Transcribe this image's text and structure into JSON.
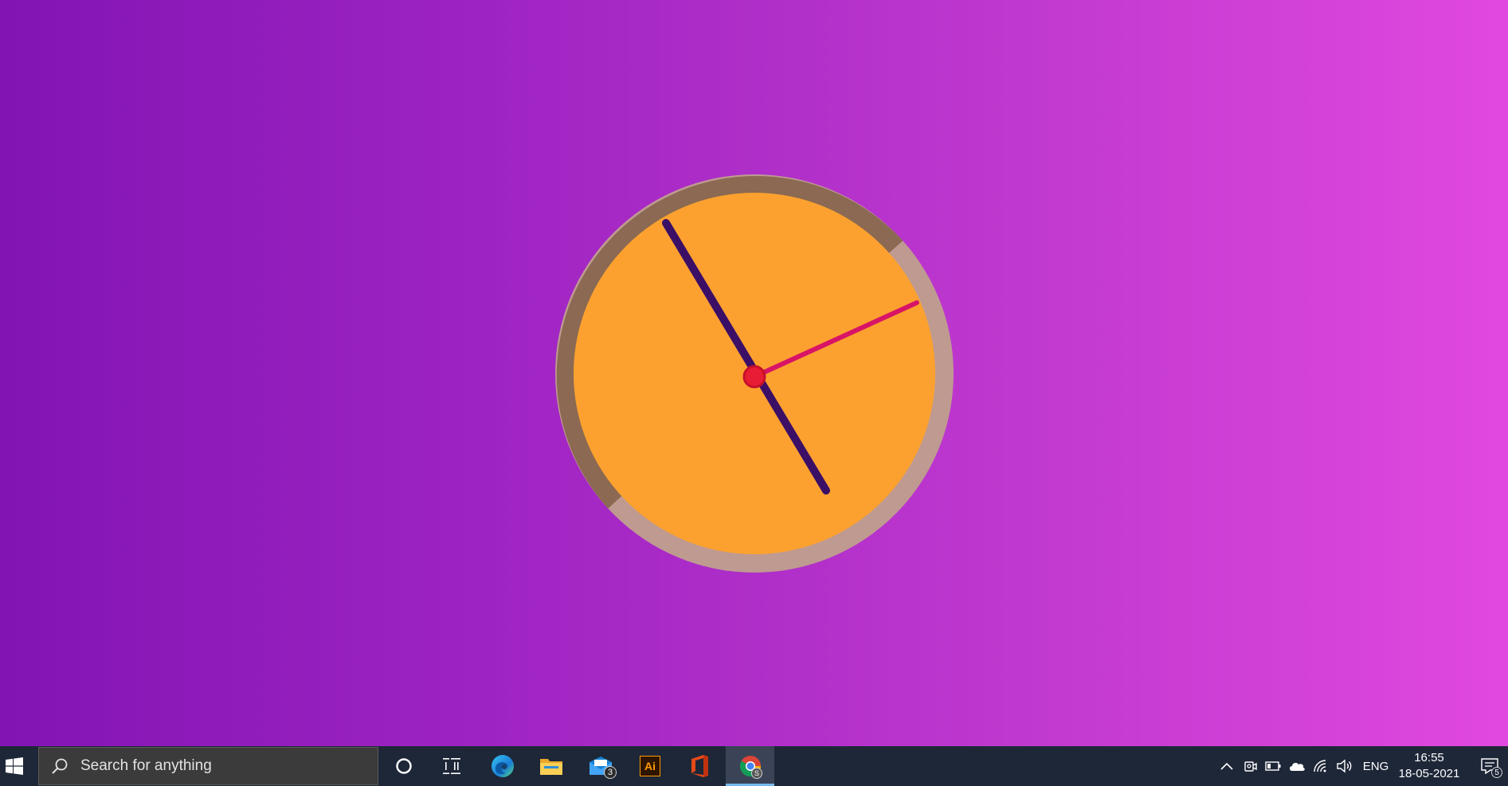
{
  "desktop": {
    "background_gradient": [
      "#8214b4",
      "#e148df"
    ]
  },
  "clock": {
    "colors": {
      "face": "#fca12f",
      "ring_dark": "#8b6952",
      "ring_light": "#bf9a91",
      "hand_minute": "#3c0f66",
      "hand_second": "#d81466",
      "center_dot": "#e81d33"
    }
  },
  "taskbar": {
    "search": {
      "placeholder": "Search for anything",
      "icon": "search-icon"
    },
    "apps": [
      {
        "name": "Cortana",
        "icon": "cortana-icon"
      },
      {
        "name": "Task View",
        "icon": "task-view-icon"
      },
      {
        "name": "Microsoft Edge",
        "icon": "edge-icon"
      },
      {
        "name": "File Explorer",
        "icon": "folder-icon"
      },
      {
        "name": "Mail",
        "icon": "mail-icon",
        "badge": "3"
      },
      {
        "name": "Adobe Illustrator",
        "icon": "illustrator-icon",
        "label": "Ai"
      },
      {
        "name": "Microsoft Office",
        "icon": "office-icon"
      },
      {
        "name": "Google Chrome",
        "icon": "chrome-icon",
        "badge": "S",
        "active": true
      }
    ],
    "tray": {
      "language": "ENG",
      "time": "16:55",
      "date": "18-05-2021",
      "notifications_badge": "5"
    }
  }
}
